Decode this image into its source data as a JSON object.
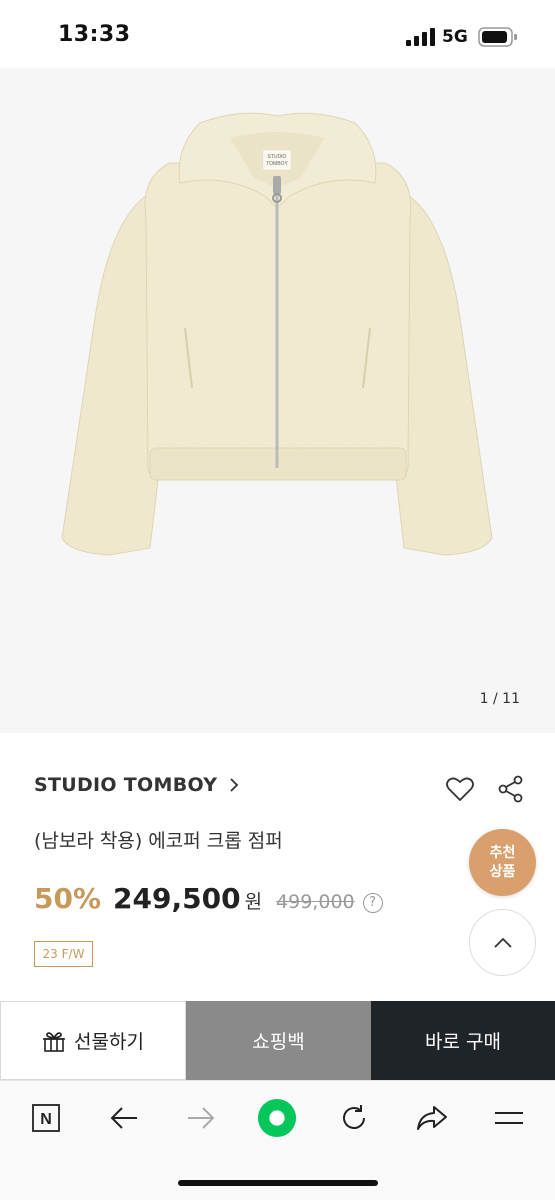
{
  "status_bar": {
    "time": "13:33",
    "network": "5G"
  },
  "gallery": {
    "counter": "1 / 11"
  },
  "product": {
    "brand": "STUDIO TOMBOY",
    "name": "(남보라 착용) 에코퍼 크롭 점퍼",
    "discount": "50%",
    "price": "249,500",
    "currency": "원",
    "original_price": "499,000",
    "help_symbol": "?",
    "season_tag": "23 F/W",
    "garment_label_lines": [
      "STUDIO",
      "TOMBOY"
    ],
    "garment_color": "#f3ecd2"
  },
  "floating": {
    "recommend_line1": "추천",
    "recommend_line2": "상품"
  },
  "actions": {
    "gift_label": "선물하기",
    "cart_label": "쇼핑백",
    "buy_label": "바로 구매"
  },
  "colors": {
    "accent": "#c89a5a",
    "recommend_bg": "#d9a06d",
    "buy_bg": "#1f2429",
    "cart_bg": "#8a8a8a",
    "naver_green": "#03c75a"
  },
  "browser_bar": {
    "home_letter": "N"
  }
}
